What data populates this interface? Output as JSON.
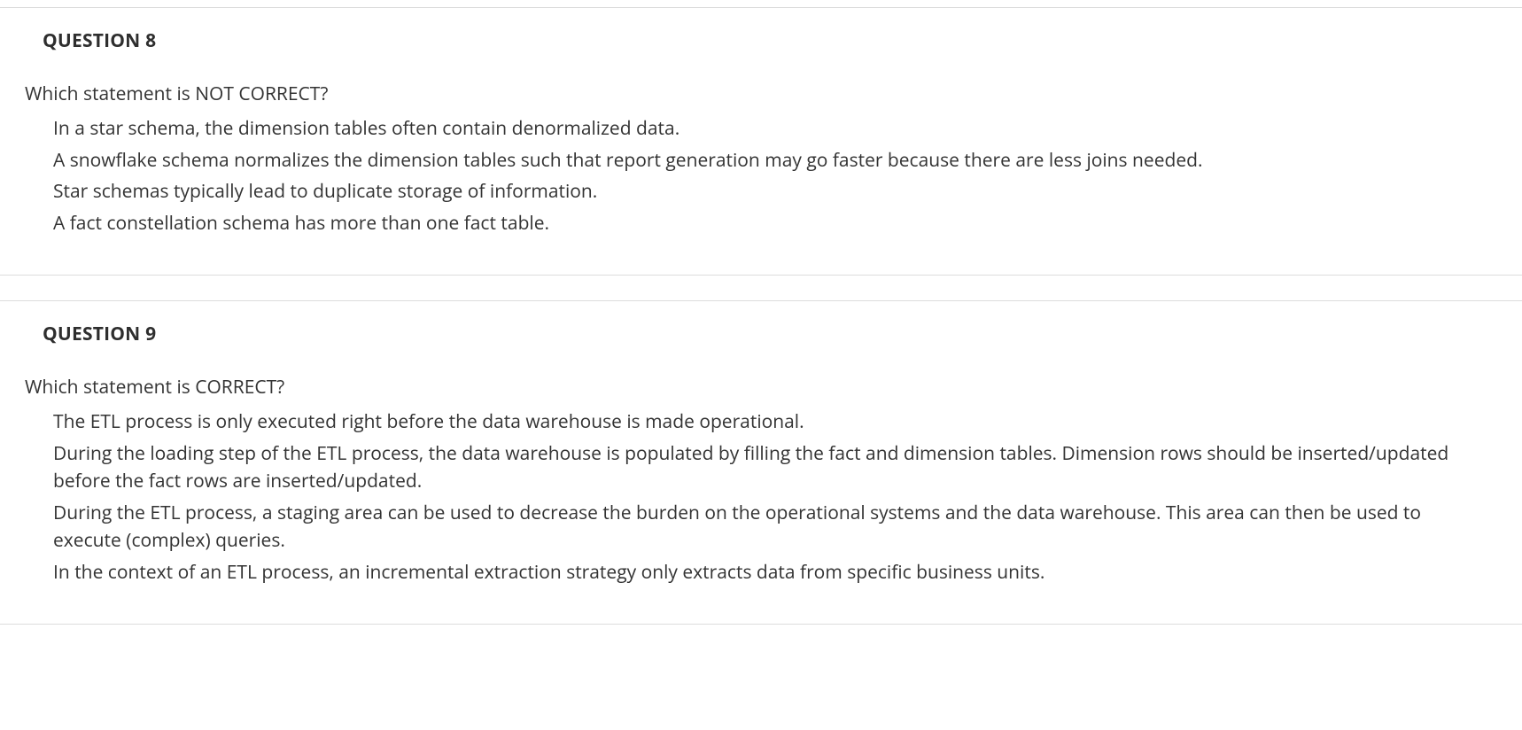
{
  "questions": [
    {
      "header": "QUESTION 8",
      "prompt": "Which statement is NOT CORRECT?",
      "options": [
        "In a star schema, the dimension tables often contain denormalized data.",
        "A snowflake schema normalizes the dimension tables such that report generation may go faster because there are less joins needed.",
        "Star schemas typically lead to duplicate storage of information.",
        "A fact constellation schema has more than one fact table."
      ]
    },
    {
      "header": "QUESTION 9",
      "prompt": "Which statement is CORRECT?",
      "options": [
        "The ETL process is only executed right before the data warehouse is made operational.",
        "During the loading step of the ETL process, the data warehouse is populated by filling the fact and dimension tables. Dimension rows should be inserted/updated before the fact rows are inserted/updated.",
        "During the ETL process, a staging area can be used to decrease the burden on the operational systems and the data warehouse. This area can then be used to execute (complex) queries.",
        "In the context of an ETL process, an incremental extraction strategy only extracts data from specific business units."
      ]
    }
  ]
}
